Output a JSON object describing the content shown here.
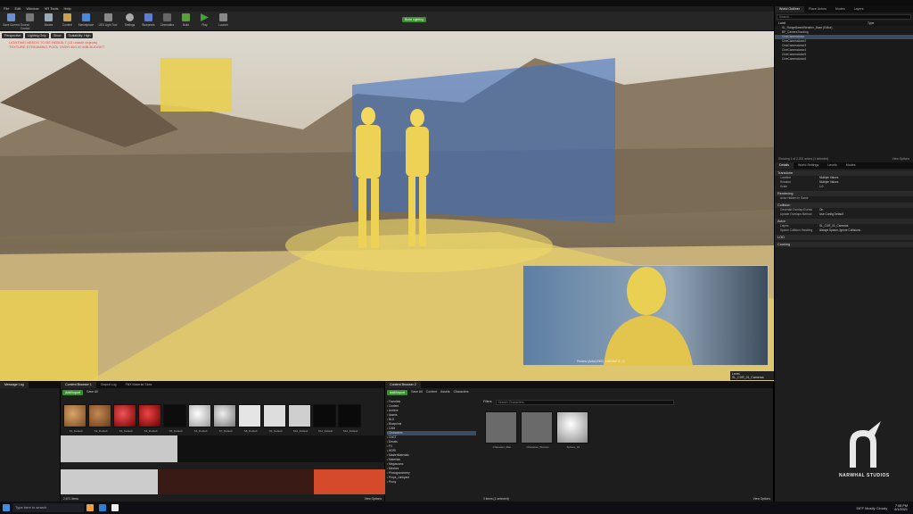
{
  "menu": [
    "File",
    "Edit",
    "Window",
    "VR Tools",
    "Help"
  ],
  "toolbar": {
    "items": [
      "Save Current",
      "Source Control",
      "Modes",
      "Content",
      "Marketplace",
      "UE4 Light Tool",
      "Settings",
      "Blueprints",
      "Cinematics",
      "Build",
      "Play",
      "Launch"
    ],
    "build_lighting": "Build Lighting"
  },
  "viewport": {
    "buttons": [
      "Perspective",
      "Lighting Only",
      "Show",
      "Scalability: High"
    ],
    "warnings": [
      "LIGHTING NEEDS TO BE REBUILT (13 unbuilt objects)",
      "TEXTURE STREAMING POOL OVER 450.00 MiB BUDGET"
    ],
    "pip_caption": "Preview (Actor) EMG_CINEMATIC_01",
    "pip_lock": "Level: SL_CXR_01_Cameras"
  },
  "outliner": {
    "tabs": [
      "World Outliner",
      "Place Actors",
      "Modes",
      "Layers"
    ],
    "search_placeholder": "Search...",
    "header": [
      "Label",
      "Type"
    ],
    "rows": [
      "SL_RangeBasedWeather_Base (Editor)",
      "BP_CameraTracking",
      "CineCameraActor",
      "CineCameraActor2",
      "CineCameraActor3",
      "CineCameraActor4",
      "CineCameraActor5",
      "CineCameraActor6"
    ],
    "status": "Showing 1 of 2,200 actors (1 selected)",
    "view_options": "View Options"
  },
  "details": {
    "tabs": [
      "Details",
      "World Settings",
      "Levels",
      "Modes"
    ],
    "sections": [
      "Transform",
      "Rendering",
      "Collision",
      "Actor",
      "LOD",
      "Cooking"
    ],
    "props": [
      [
        "Location",
        "Multiple Values"
      ],
      [
        "Rotation",
        "Multiple Values"
      ],
      [
        "Scale",
        "1.0"
      ],
      [
        "Actor Hidden In Game",
        ""
      ],
      [
        "Generate Overlap Events",
        "On"
      ],
      [
        "Update Overlaps Method",
        "Use Config Default"
      ],
      [
        "Layers",
        "SL_CXR_01_Cameras"
      ],
      [
        "Spawn Collision Handling",
        "Always Spawn, Ignore Collisions"
      ]
    ]
  },
  "content_left": {
    "tabs": [
      "Message Log",
      "Content Browser 1",
      "Output Log",
      "FBX Material Slots"
    ],
    "add_import": "Add/Import",
    "save_all": "Save All",
    "items": [
      "S1_Default",
      "S2_Default",
      "S3_Default",
      "S4_Default",
      "S5_Default",
      "S6_Default",
      "S7_Default",
      "S8_Default",
      "S9_Default",
      "S10_Default",
      "S11_Default",
      "S12_Default"
    ],
    "status": "2,671 items",
    "view_options": "View Options"
  },
  "content_right": {
    "tab": "Content Browser 2",
    "add_import": "Add/Import",
    "save_all": "Save All",
    "path": [
      "Content",
      "Assets",
      "Characters"
    ],
    "filters": "Filters",
    "search_placeholder": "Search Characters",
    "folders": [
      "Favorites",
      "Content",
      "Archive",
      "Assets",
      "BLD",
      "Blueprints",
      "CAM",
      "Characters",
      "CNCT",
      "Decals",
      "FX",
      "HDRI",
      "MasterMaterials",
      "Materials",
      "Megascans",
      "Meshes",
      "Photogrammetry",
      "Props_Junkyard",
      "Proxy"
    ],
    "assets": [
      "Character_Man",
      "Character_Woman",
      "Sphere_01"
    ],
    "status": "3 items (1 selected)",
    "view_options": "View Options"
  },
  "taskbar": {
    "search": "Type here to search",
    "weather": "56°F  Mostly Cloudy",
    "time": "7:08 PM",
    "date": "6/1/2021"
  },
  "watermark": "NARWHAL STUDIOS",
  "colors": {
    "accent": "#3a4b66",
    "green": "#3c8d2f",
    "highlight": "#e9cf52",
    "blue": "#3f6fc0"
  }
}
